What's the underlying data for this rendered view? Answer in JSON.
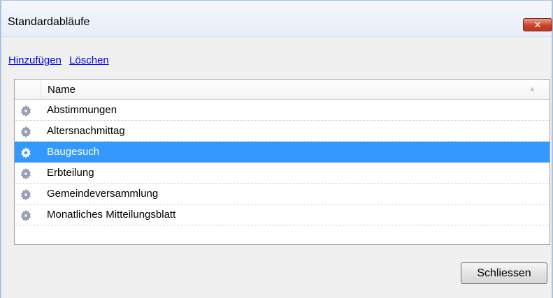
{
  "window": {
    "title": "Standardabläufe",
    "close_symbol": "✕"
  },
  "links": {
    "add": "Hinzufügen",
    "delete": "Löschen"
  },
  "list": {
    "column_name": "Name",
    "sort_indicator": "▲",
    "icon": "gear-icon",
    "items": [
      {
        "label": "Abstimmungen"
      },
      {
        "label": "Altersnachmittag"
      },
      {
        "label": "Baugesuch",
        "selected": true
      },
      {
        "label": "Erbteilung"
      },
      {
        "label": "Gemeindeversammlung"
      },
      {
        "label": "Monatliches Mitteilungsblatt"
      }
    ]
  },
  "footer": {
    "close_label": "Schliessen"
  },
  "colors": {
    "selection": "#3399ff",
    "link": "#0000ee",
    "close_red": "#c9442a"
  }
}
